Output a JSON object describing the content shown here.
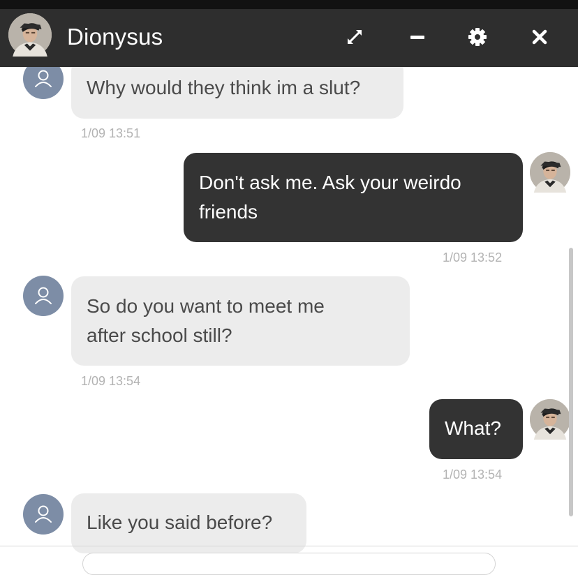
{
  "header": {
    "name": "Dionysus",
    "avatar_icon": "profile-photo",
    "controls": [
      "expand-icon",
      "minimize-icon",
      "gear-icon",
      "close-icon"
    ]
  },
  "messages": [
    {
      "side": "incoming",
      "text": "Why would they think im a slut?",
      "time": "1/09 13:51"
    },
    {
      "side": "outgoing",
      "text": "Don't ask me. Ask your weirdo friends",
      "time": "1/09 13:52"
    },
    {
      "side": "incoming",
      "text": "So do you want to meet me after school still?",
      "time": "1/09 13:54"
    },
    {
      "side": "outgoing",
      "text": "What?",
      "time": "1/09 13:54"
    },
    {
      "side": "incoming",
      "text": "Like you said before?",
      "time": ""
    }
  ],
  "colors": {
    "header_bg": "#2e2e2e",
    "incoming_bubble": "#ececec",
    "outgoing_bubble": "#333333",
    "user_avatar": "#7d8da6",
    "timestamp": "#b3b3b3"
  }
}
